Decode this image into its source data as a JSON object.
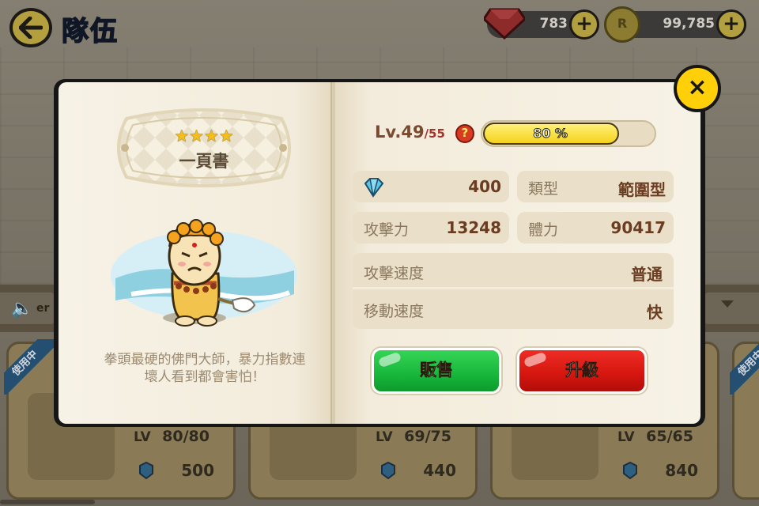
{
  "screen": {
    "title": "隊伍",
    "currency": {
      "gems": "783",
      "coins": "99,785",
      "coin_symbol": "R",
      "plus_label": "+"
    }
  },
  "side_controls": {
    "text": "er"
  },
  "team_cards": [
    {
      "badge": "使用中",
      "lv_label": "LV",
      "level": "80",
      "level_max": "80",
      "cost": "500"
    },
    {
      "lv_label": "LV",
      "level": "69",
      "level_max": "75",
      "cost": "440"
    },
    {
      "lv_label": "LV",
      "level": "65",
      "level_max": "65",
      "cost": "840"
    },
    {
      "badge": "使用中"
    }
  ],
  "hero": {
    "stars": 4,
    "stars_text": "★★★★",
    "name": "一頁書",
    "description_line1": "拳頭最硬的佛門大師，暴力指數連",
    "description_line2": "壞人看到都會害怕！",
    "level_prefix": "Lv.49",
    "level_max": "/55",
    "help_label": "?",
    "xp_percent": 80,
    "xp_text": "80 %",
    "stats": {
      "gem_value": "400",
      "type_label": "類型",
      "type_value": "範圍型",
      "attack_label": "攻擊力",
      "attack_value": "13248",
      "hp_label": "體力",
      "hp_value": "90417",
      "attack_speed_label": "攻擊速度",
      "attack_speed_value": "普通",
      "move_speed_label": "移動速度",
      "move_speed_value": "快"
    }
  },
  "buttons": {
    "sell": "販售",
    "upgrade": "升級",
    "close": "×"
  },
  "colors": {
    "sell_green": "#1fc145",
    "upgrade_red": "#d8170f",
    "close_yellow": "#ffcf0a",
    "xp_yellow": "#f4d21c"
  }
}
